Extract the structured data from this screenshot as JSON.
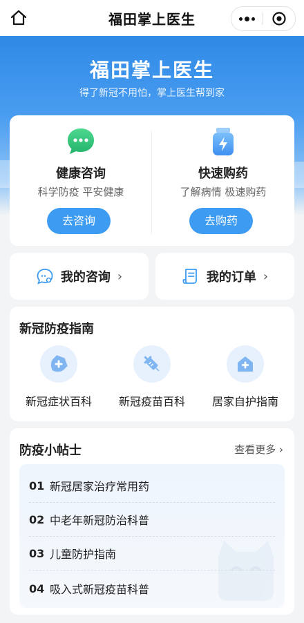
{
  "nav": {
    "title": "福田掌上医生"
  },
  "hero": {
    "title": "福田掌上医生",
    "subtitle": "得了新冠不用怕，掌上医生帮到家"
  },
  "services": [
    {
      "title": "健康咨询",
      "subtitle": "科学防疫 平安健康",
      "button": "去咨询",
      "icon": "chat-bubble-icon"
    },
    {
      "title": "快速购药",
      "subtitle": "了解病情 极速购药",
      "button": "去购药",
      "icon": "medicine-bottle-icon"
    }
  ],
  "my": {
    "consult": "我的咨询",
    "orders": "我的订单"
  },
  "guide": {
    "title": "新冠防疫指南",
    "items": [
      {
        "label": "新冠症状百科",
        "icon": "medical-shield-icon"
      },
      {
        "label": "新冠疫苗百科",
        "icon": "syringe-icon"
      },
      {
        "label": "居家自护指南",
        "icon": "home-care-icon"
      }
    ]
  },
  "tips": {
    "title": "防疫小帖士",
    "more": "查看更多",
    "items": [
      {
        "num": "01",
        "text": "新冠居家治疗常用药"
      },
      {
        "num": "02",
        "text": "中老年新冠防治科普"
      },
      {
        "num": "03",
        "text": "儿童防护指南"
      },
      {
        "num": "04",
        "text": "吸入式新冠疫苗科普"
      }
    ]
  },
  "colors": {
    "accent": "#3d9cf2",
    "green": "#2fc277",
    "hero": "#2f8ae6"
  }
}
